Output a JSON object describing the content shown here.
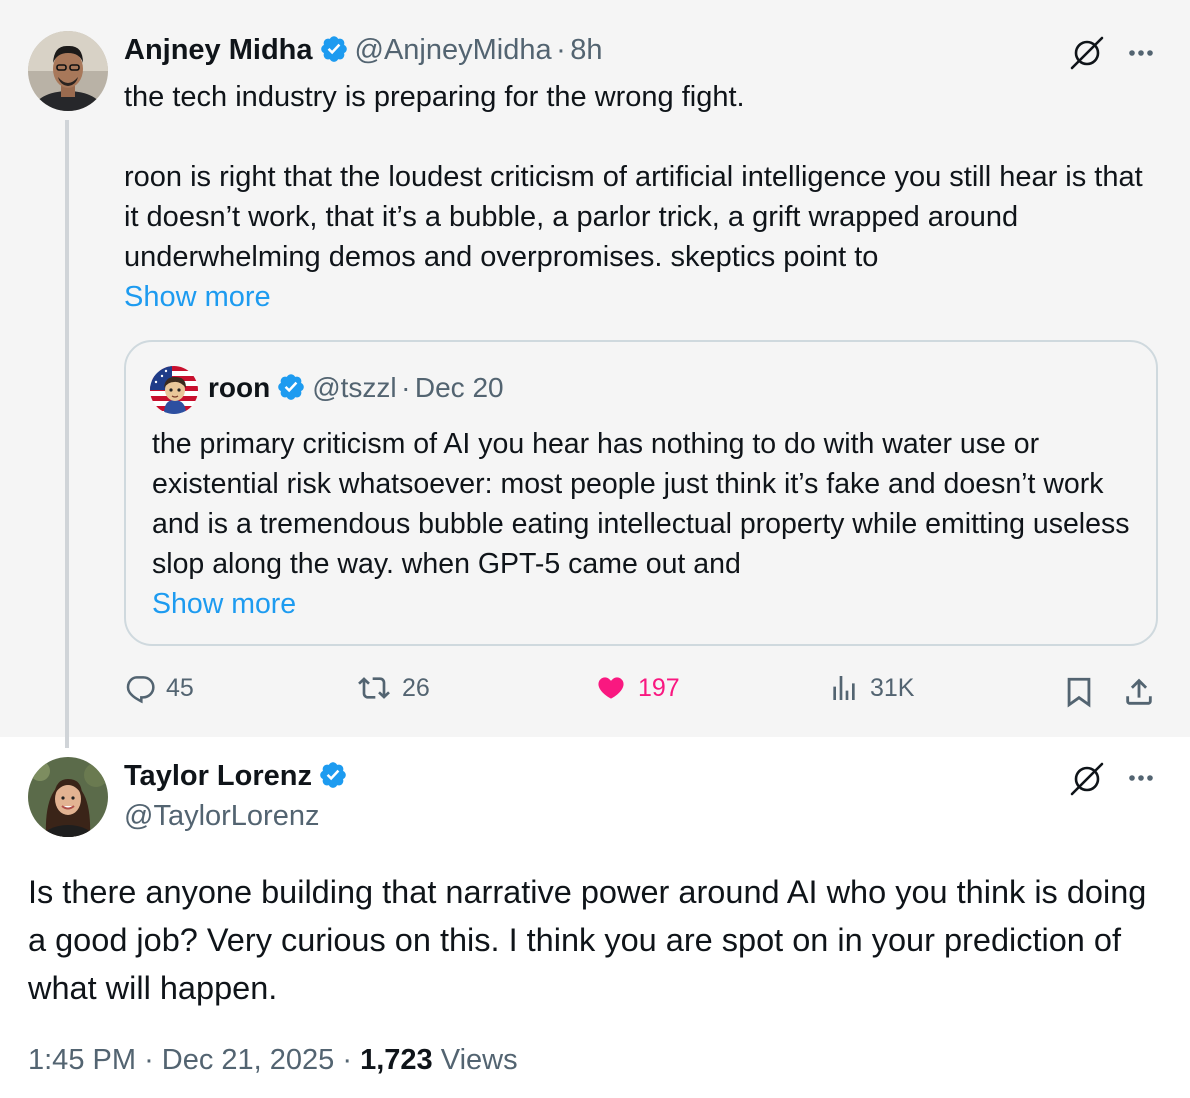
{
  "parent_tweet": {
    "author_name": "Anjney Midha",
    "handle": "@AnjneyMidha",
    "separator": "·",
    "time": "8h",
    "text_line1": "the tech industry is preparing for the wrong fight.",
    "text_para2": "roon is right that the loudest criticism of artificial intelligence you still hear is that it doesn’t work, that it’s a bubble, a parlor trick, a grift wrapped around underwhelming demos and overpromises. skeptics point to",
    "show_more": "Show more",
    "quote": {
      "author_name": "roon",
      "handle": "@tszzl",
      "separator": "·",
      "date": "Dec 20",
      "text": "the primary criticism of AI you hear has nothing to do with water use or existential risk whatsoever: most people just think it’s fake and doesn’t work and is a tremendous bubble eating intellectual property while emitting useless slop along the way. when GPT-5 came out and",
      "show_more": "Show more"
    },
    "actions": {
      "replies": "45",
      "reposts": "26",
      "likes": "197",
      "views": "31K"
    }
  },
  "reply_tweet": {
    "author_name": "Taylor Lorenz",
    "handle": "@TaylorLorenz",
    "text": "Is there anyone building that narrative power around AI who you think is doing a good job? Very curious on this. I think you are spot on in your prediction of what will happen.",
    "time": "1:45 PM",
    "separator1": "·",
    "date": "Dec 21, 2025",
    "separator2": "·",
    "views_count": "1,723",
    "views_label": "Views"
  },
  "colors": {
    "verified": "#1d9bf0",
    "link": "#1d9bf0",
    "like": "#f91880",
    "muted": "#536471",
    "parent_bg": "#f5f5f5"
  },
  "icons": [
    "verified-badge-icon",
    "grok-icon",
    "more-icon",
    "reply-icon",
    "repost-icon",
    "heart-icon",
    "views-icon",
    "bookmark-icon",
    "share-icon"
  ]
}
